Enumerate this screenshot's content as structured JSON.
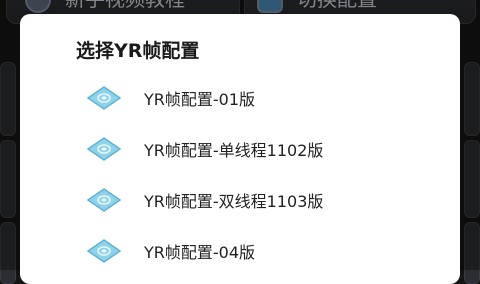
{
  "background": {
    "left_card_label": "新手视频教程",
    "right_card_label": "切换配置"
  },
  "dialog": {
    "title": "选择YR帧配置",
    "options": [
      {
        "label": "YR帧配置-01版",
        "icon": "diamond-icon"
      },
      {
        "label": "YR帧配置-单线程1102版",
        "icon": "diamond-icon"
      },
      {
        "label": "YR帧配置-双线程1103版",
        "icon": "diamond-icon"
      },
      {
        "label": "YR帧配置-04版",
        "icon": "diamond-icon"
      }
    ]
  },
  "colors": {
    "icon_fill": "#8fd3ea",
    "icon_stroke": "#5fb3d3",
    "dialog_bg": "#ffffff",
    "backdrop": "#141414"
  }
}
